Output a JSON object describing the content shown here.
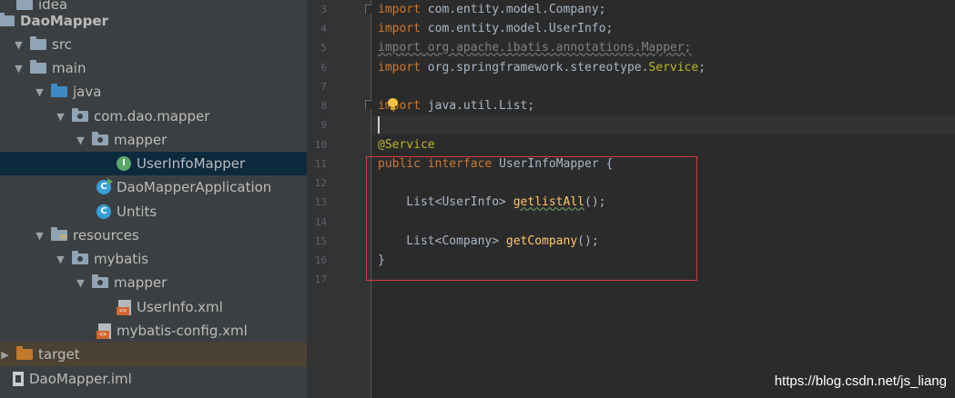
{
  "project_tree": {
    "items": [
      {
        "label": "idea"
      },
      {
        "label": "DaoMapper"
      },
      {
        "label": "src"
      },
      {
        "label": "main"
      },
      {
        "label": "java"
      },
      {
        "label": "com.dao.mapper"
      },
      {
        "label": "mapper"
      },
      {
        "label": "UserInfoMapper",
        "icon_text": "I"
      },
      {
        "label": "DaoMapperApplication",
        "icon_text": "C"
      },
      {
        "label": "Untits",
        "icon_text": "C"
      },
      {
        "label": "resources"
      },
      {
        "label": "mybatis"
      },
      {
        "label": "mapper"
      },
      {
        "label": "UserInfo.xml"
      },
      {
        "label": "mybatis-config.xml"
      },
      {
        "label": "target"
      },
      {
        "label": "DaoMapper.iml"
      }
    ]
  },
  "editor": {
    "line_numbers": [
      "3",
      "4",
      "5",
      "6",
      "7",
      "8",
      "9",
      "10",
      "11",
      "12",
      "13",
      "14",
      "15",
      "16",
      "17"
    ],
    "lines": {
      "l3": {
        "kw": "import",
        "rest": " com.entity.model.Company;"
      },
      "l4": {
        "kw": "import",
        "rest": " com.entity.model.UserInfo;"
      },
      "l5": {
        "text": "import org.apache.ibatis.annotations.Mapper;"
      },
      "l6": {
        "kw": "import",
        "rest": " org.springframework.stereotype.",
        "cls": "Service",
        "end": ";"
      },
      "l8": {
        "kw": "import",
        "rest": " java.util.List;"
      },
      "l10": {
        "ann": "@Service"
      },
      "l11": {
        "kw1": "public",
        "kw2": " interface",
        "rest": " UserInfoMapper {"
      },
      "l13": {
        "pre": "    List<UserInfo> ",
        "fn": "getlistAll",
        "end": "();"
      },
      "l15": {
        "pre": "    List<Company> ",
        "fn": "getCompany",
        "end": "();"
      },
      "l16": {
        "text": "}"
      }
    }
  },
  "watermark": "https://blog.csdn.net/js_liang",
  "colors": {
    "keyword": "#cc7832",
    "annotation": "#bbb529",
    "method": "#ffc66d",
    "highlight_box": "#d83a3a"
  }
}
